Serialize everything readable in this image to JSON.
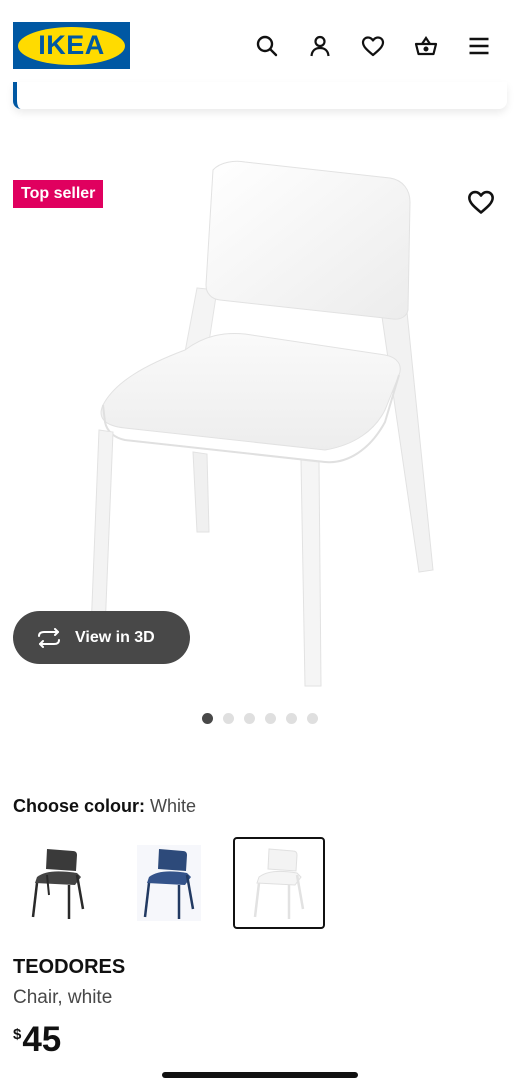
{
  "brand": {
    "logo_text": "IKEA",
    "blue": "#0058a3",
    "yellow": "#ffdb00"
  },
  "header": {
    "icons": [
      "search-icon",
      "account-icon",
      "favourites-icon",
      "cart-icon",
      "menu-icon"
    ]
  },
  "gallery": {
    "badge": "Top seller",
    "badge_color": "#e0005f",
    "view_3d_label": "View in 3D",
    "dot_count": 6,
    "active_dot": 0
  },
  "colour": {
    "label": "Choose colour:",
    "selected": "White",
    "options": [
      {
        "name": "Black",
        "color": "#3a3a3a"
      },
      {
        "name": "Blue",
        "color": "#2d4a7a"
      },
      {
        "name": "White",
        "color": "#f2f2f2"
      }
    ]
  },
  "product": {
    "name": "TEODORES",
    "description": "Chair, white",
    "currency": "$",
    "price": "45"
  }
}
